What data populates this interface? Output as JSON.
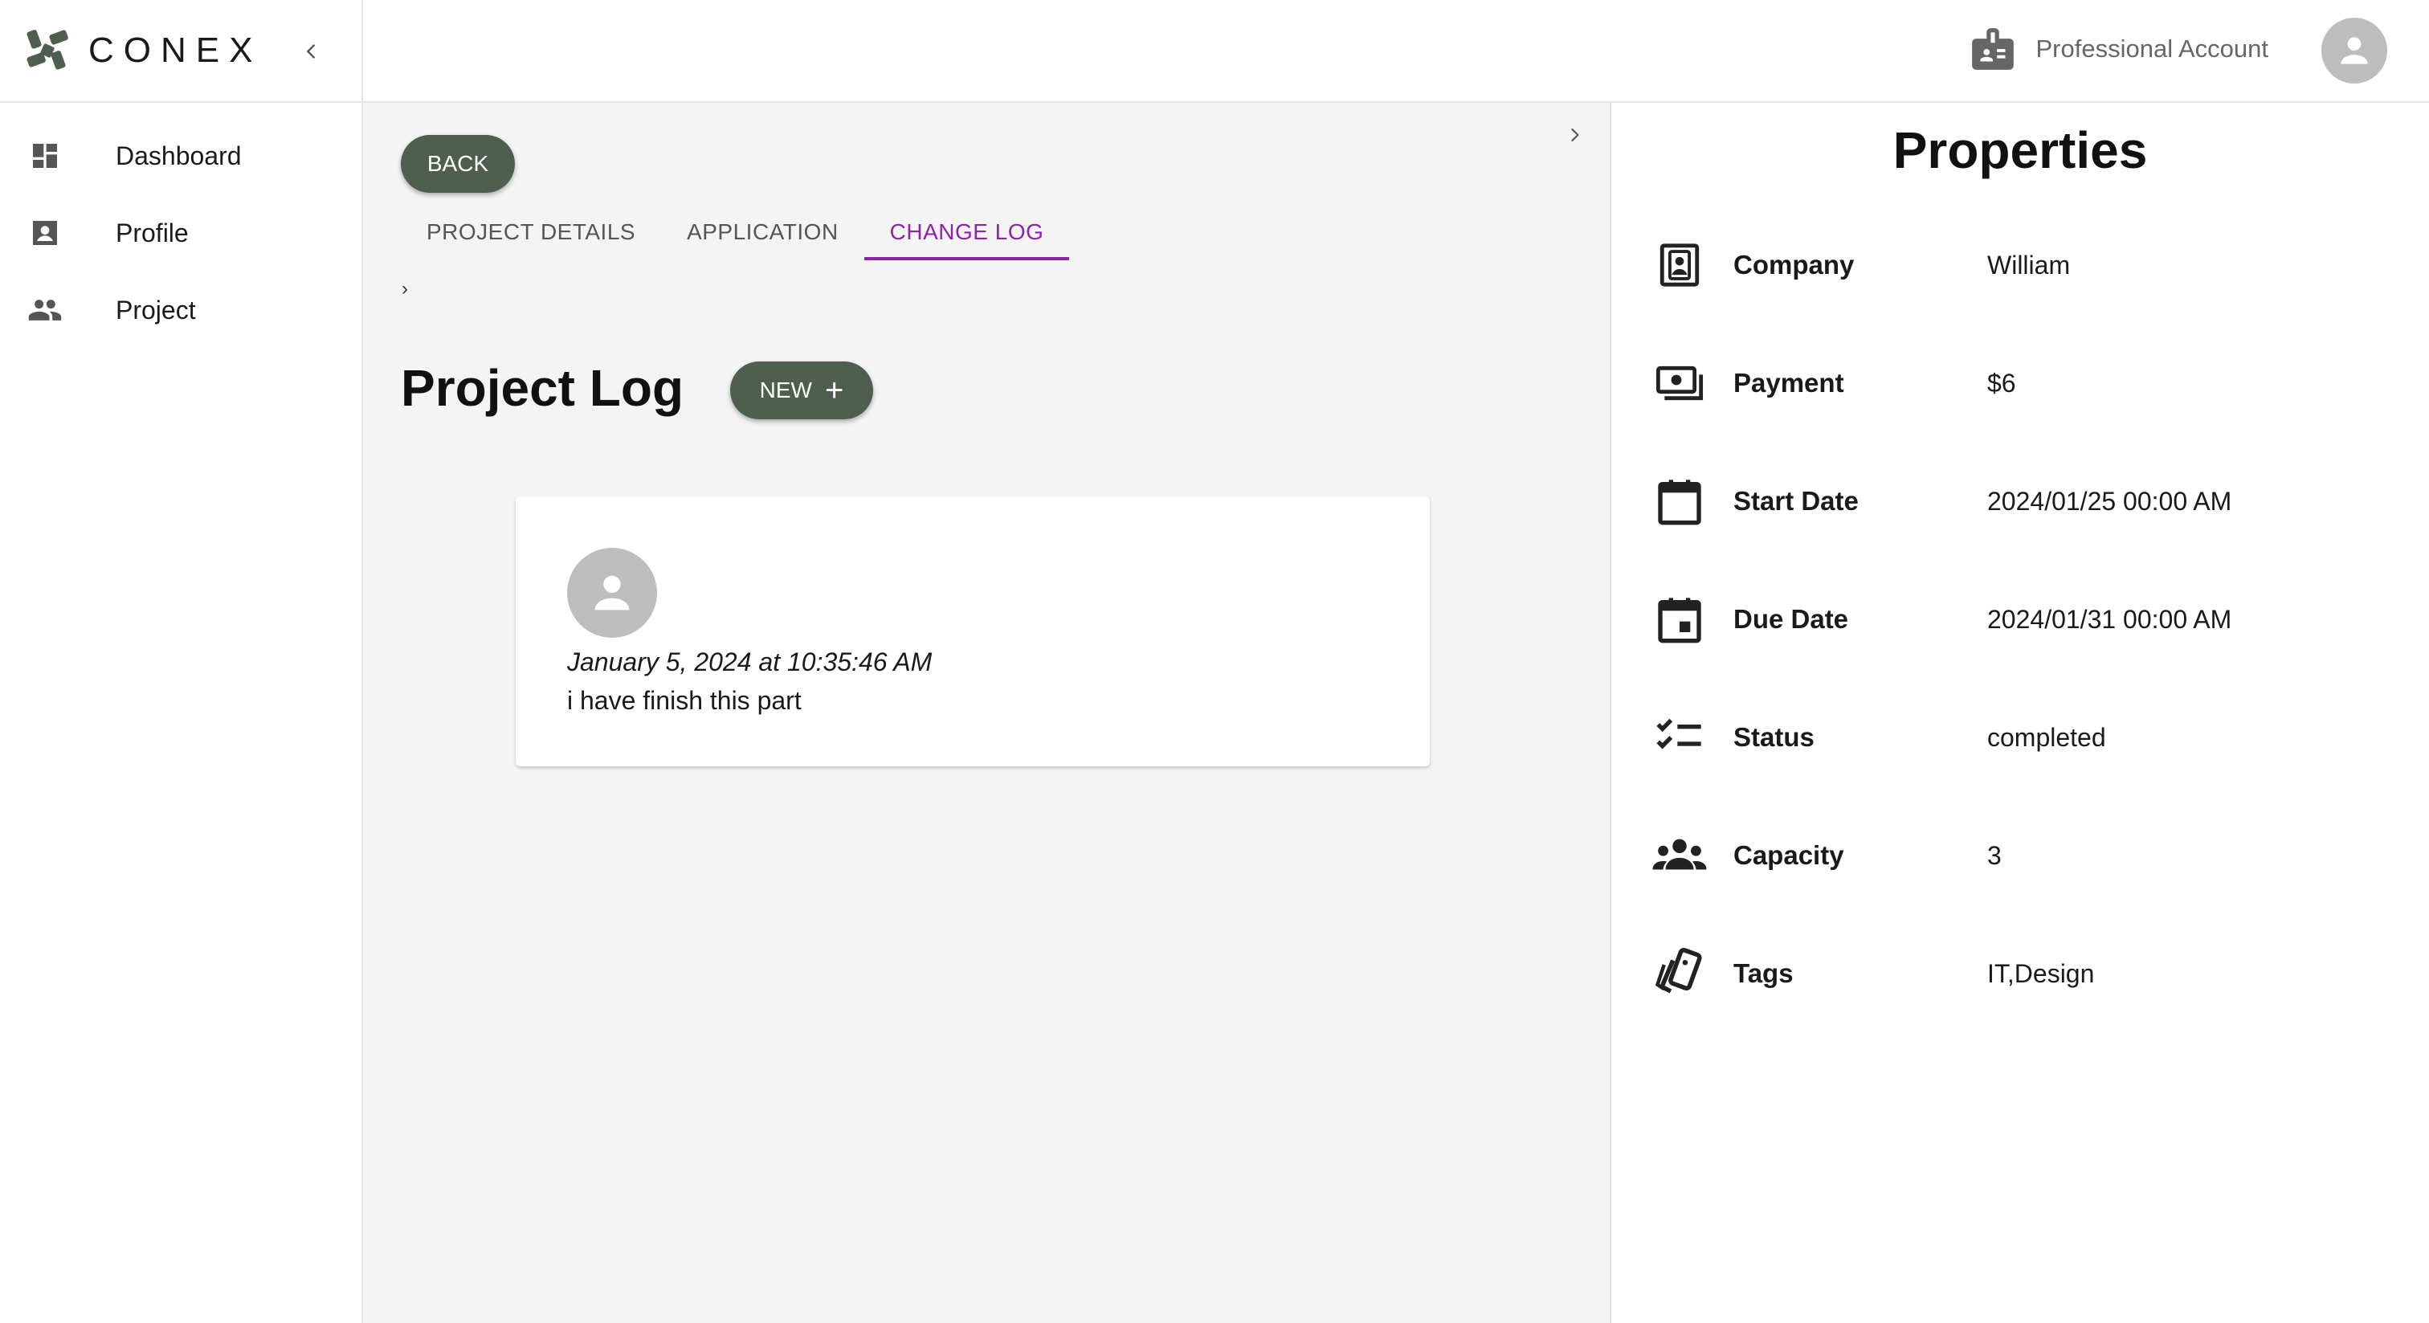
{
  "brand": {
    "name": "CONEX",
    "accent": "#4f5f4f"
  },
  "sidebar": {
    "items": [
      {
        "label": "Dashboard",
        "icon": "dashboard-icon"
      },
      {
        "label": "Profile",
        "icon": "profile-icon"
      },
      {
        "label": "Project",
        "icon": "people-icon"
      }
    ]
  },
  "header": {
    "account_label": "Professional Account"
  },
  "main": {
    "back_label": "BACK",
    "tabs": [
      {
        "label": "PROJECT DETAILS",
        "active": false
      },
      {
        "label": "APPLICATION",
        "active": false
      },
      {
        "label": "CHANGE LOG",
        "active": true
      }
    ],
    "breadcrumb": "›",
    "title": "Project Log",
    "new_label": "NEW",
    "new_icon": "+",
    "logs": [
      {
        "timestamp": "January 5, 2024 at 10:35:46 AM",
        "text": "i have finish this part"
      }
    ]
  },
  "properties": {
    "title": "Properties",
    "rows": [
      {
        "label": "Company",
        "value": "William",
        "icon": "contact-icon"
      },
      {
        "label": "Payment",
        "value": "$6",
        "icon": "payments-icon"
      },
      {
        "label": "Start Date",
        "value": "2024/01/25 00:00 AM",
        "icon": "calendar-icon"
      },
      {
        "label": "Due Date",
        "value": "2024/01/31 00:00 AM",
        "icon": "event-icon"
      },
      {
        "label": "Status",
        "value": "completed",
        "icon": "checklist-icon"
      },
      {
        "label": "Capacity",
        "value": "3",
        "icon": "groups-icon"
      },
      {
        "label": "Tags",
        "value": "IT,Design",
        "icon": "tags-icon"
      }
    ]
  },
  "colors": {
    "active_tab": "#8e24aa",
    "button": "#4f5f4f"
  }
}
